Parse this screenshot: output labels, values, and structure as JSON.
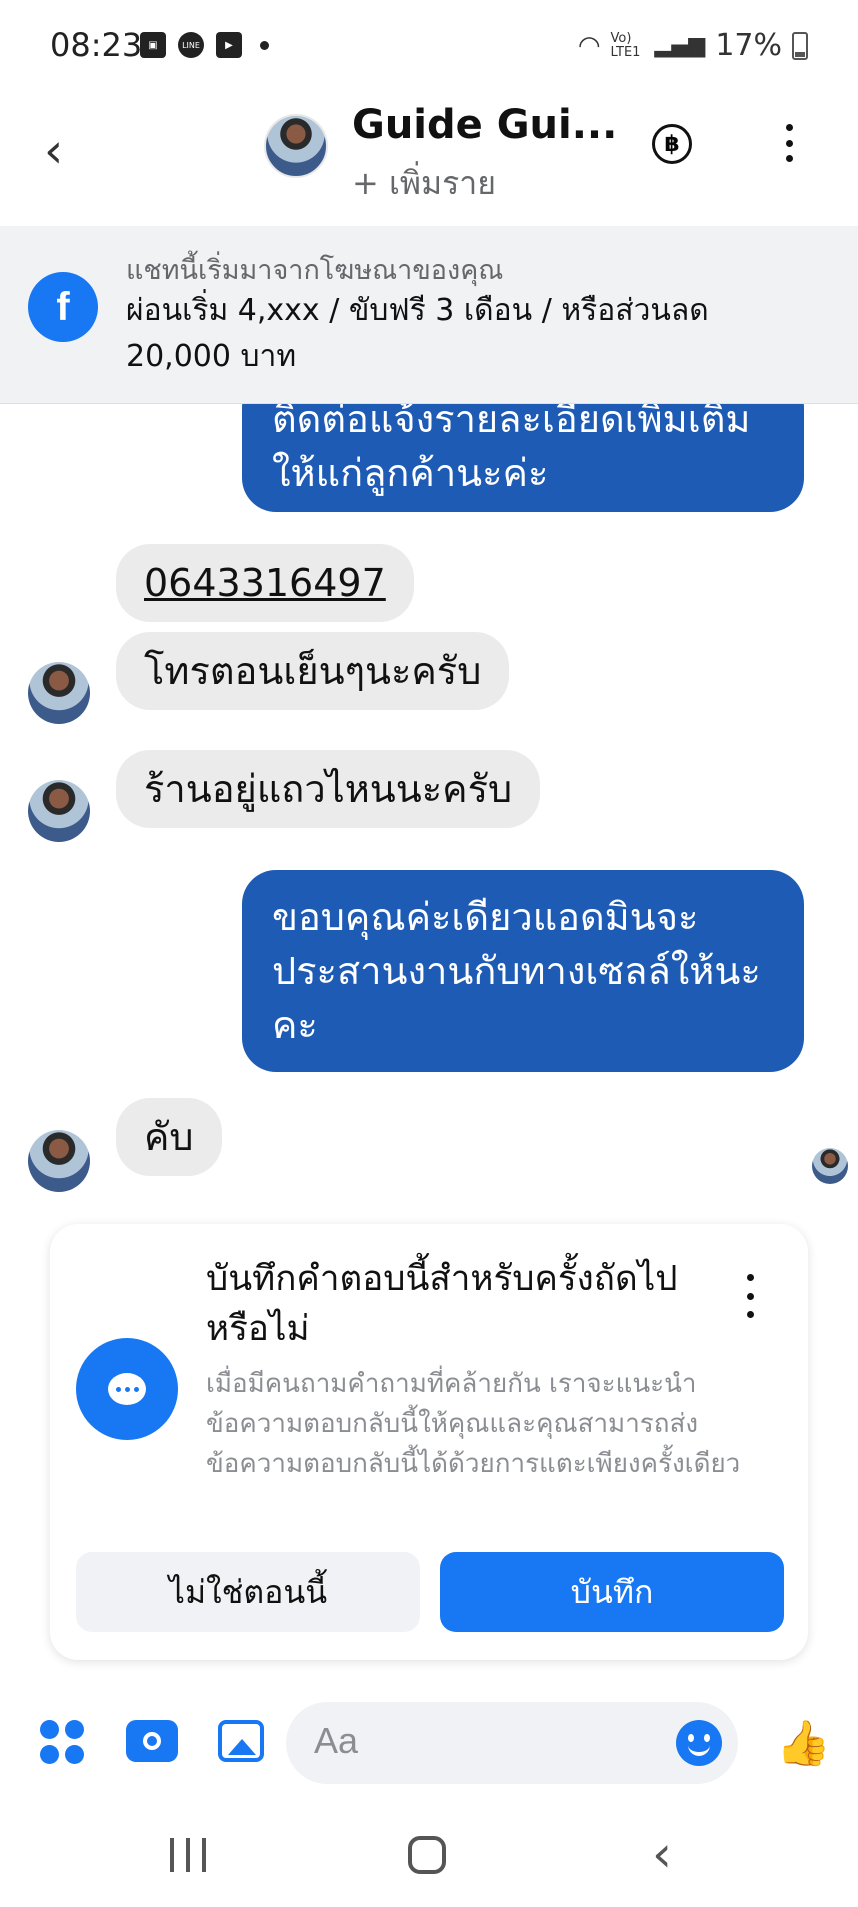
{
  "status_bar": {
    "time": "08:23",
    "left_icons": [
      "gallery-icon",
      "line-icon",
      "youtube-icon",
      "dot-icon"
    ],
    "line_label": "LINE",
    "battery": "17%",
    "network": "Vo) LTE1"
  },
  "header": {
    "name": "Guide Gui...",
    "subtitle": "+ เพิ่มราย",
    "currency_symbol": "฿"
  },
  "ad_banner": {
    "label": "แชทนี้เริ่มมาจากโฆษณาของคุณ",
    "text": "ผ่อนเริ่ม 4,xxx / ขับฟรี  3 เดือน / หรือส่วนลด 20,000 บาท"
  },
  "messages": [
    {
      "direction": "out",
      "text": "ติดต่อแจ้งรายละเอียดเพิ่มเติม ให้แก่ลูกค้านะค่ะ"
    },
    {
      "direction": "in",
      "text": "0643316497"
    },
    {
      "direction": "in",
      "text": "โทรตอนเย็นๆนะครับ"
    },
    {
      "direction": "in",
      "text": "ร้านอยู่แถวไหนนะครับ"
    },
    {
      "direction": "out",
      "text": "ขอบคุณค่ะเดียวแอดมินจะประสานงานกับทางเซลล์ให้นะคะ"
    },
    {
      "direction": "in",
      "text": "คับ"
    }
  ],
  "save_reply_card": {
    "title": "บันทึกคำตอบนี้สำหรับครั้งถัดไปหรือไม่",
    "description": "เมื่อมีคนถามคำถามที่คล้ายกัน เราจะแนะนำข้อความตอบกลับนี้ให้คุณและคุณสามารถส่งข้อความตอบกลับนี้ได้ด้วยการแตะเพียงครั้งเดียว",
    "not_now_label": "ไม่ใช่ตอนนี้",
    "save_label": "บันทึก"
  },
  "composer": {
    "placeholder": "Aa",
    "like_glyph": "👍"
  },
  "colors": {
    "accent": "#1877f2",
    "outgoing_bubble": "#1e5bb5",
    "incoming_bubble": "#ebebeb"
  }
}
